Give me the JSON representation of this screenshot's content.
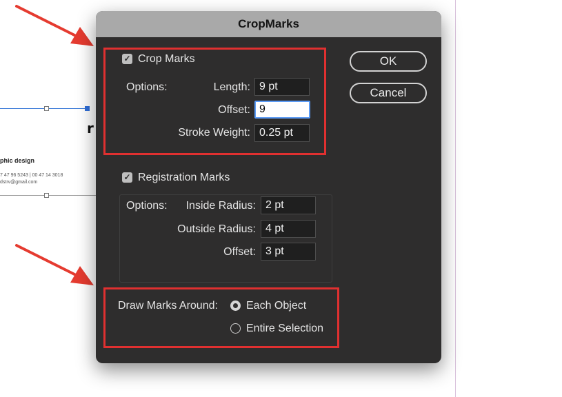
{
  "dialog": {
    "title": "CropMarks",
    "ok_label": "OK",
    "cancel_label": "Cancel"
  },
  "crop_marks": {
    "label": "Crop Marks",
    "checked": true,
    "options_label": "Options:",
    "length_label": "Length:",
    "length_value": "9 pt",
    "offset_label": "Offset:",
    "offset_value": "9",
    "stroke_label": "Stroke Weight:",
    "stroke_value": "0.25 pt"
  },
  "registration_marks": {
    "label": "Registration Marks",
    "checked": true,
    "options_label": "Options:",
    "inside_label": "Inside Radius:",
    "inside_value": "2 pt",
    "outside_label": "Outside Radius:",
    "outside_value": "4 pt",
    "offset_label": "Offset:",
    "offset_value": "3 pt"
  },
  "draw_marks": {
    "label": "Draw Marks Around:",
    "options": [
      "Each Object",
      "Entire Selection"
    ],
    "selected": "Each Object"
  },
  "background": {
    "design_text": "phic design",
    "phone_text": "7 47 96 5243 | 00 47 14 3018",
    "email_text": "dstrv@gmail.com"
  },
  "colors": {
    "highlight": "#e03030",
    "arrow": "#e53b30",
    "dialog_bg": "#2e2d2d",
    "titlebar": "#a9a9a9",
    "selection": "#2f6ed9"
  }
}
